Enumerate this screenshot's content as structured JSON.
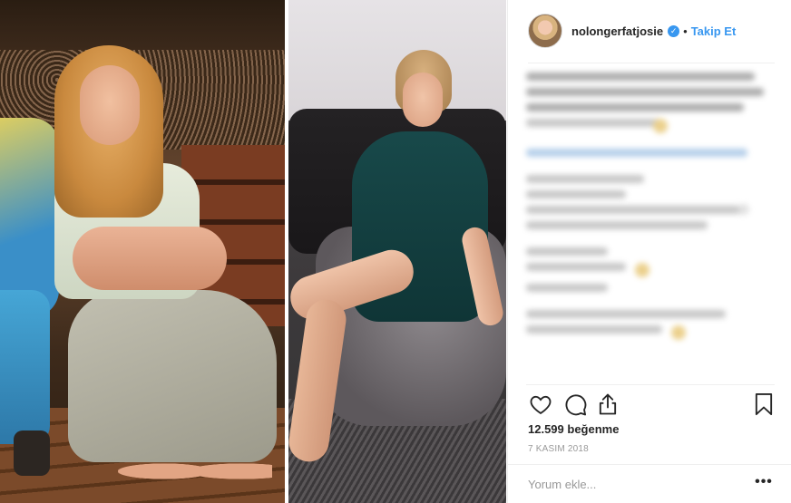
{
  "post": {
    "username": "nolongerfatjosie",
    "verified": true,
    "separator": "•",
    "follow_label": "Takip Et",
    "likes_text": "12.599 beğenme",
    "date_text": "7 KASIM 2018",
    "comment_placeholder": "Yorum ekle...",
    "more_label": "•••"
  },
  "icons": {
    "like": "heart-outline-icon",
    "comment": "speech-bubble-icon",
    "share": "share-upload-icon",
    "save": "bookmark-outline-icon",
    "verified": "verified-badge-icon"
  },
  "colors": {
    "accent": "#3897f0",
    "text": "#262626",
    "muted": "#999999",
    "border": "#efefef"
  }
}
